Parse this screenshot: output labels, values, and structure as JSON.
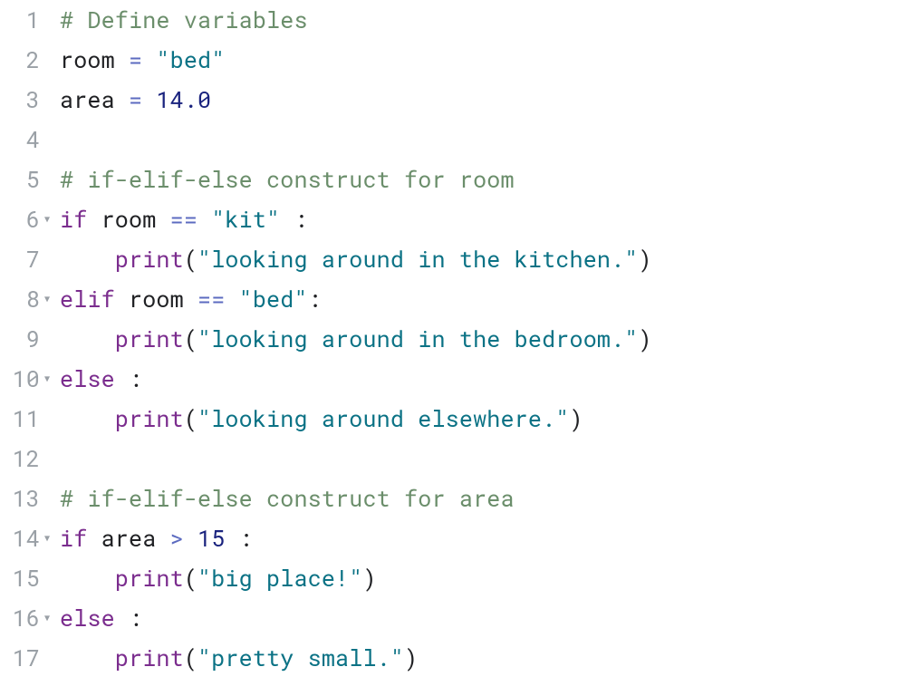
{
  "colors": {
    "comment": "#6b8e6b",
    "keyword": "#7b2d8e",
    "func": "#7b2d8e",
    "plain": "#202124",
    "operator": "#5c6bc0",
    "string": "#0b7285",
    "number": "#1a237e",
    "gutter": "#9aa0a6",
    "bg": "#ffffff"
  },
  "line_numbers": [
    "1",
    "2",
    "3",
    "4",
    "5",
    "6",
    "7",
    "8",
    "9",
    "10",
    "11",
    "12",
    "13",
    "14",
    "15",
    "16",
    "17"
  ],
  "fold_markers": {
    "6": "▼",
    "8": "▼",
    "10": "▼",
    "14": "▼",
    "16": "▼"
  },
  "lines": [
    [
      {
        "cls": "cm",
        "t": "# Define variables"
      }
    ],
    [
      {
        "cls": "var",
        "t": "room"
      },
      {
        "cls": "var",
        "t": " "
      },
      {
        "cls": "op",
        "t": "="
      },
      {
        "cls": "var",
        "t": " "
      },
      {
        "cls": "str",
        "t": "\"bed\""
      }
    ],
    [
      {
        "cls": "var",
        "t": "area"
      },
      {
        "cls": "var",
        "t": " "
      },
      {
        "cls": "op",
        "t": "="
      },
      {
        "cls": "var",
        "t": " "
      },
      {
        "cls": "num",
        "t": "14.0"
      }
    ],
    [
      {
        "cls": "var",
        "t": ""
      }
    ],
    [
      {
        "cls": "cm",
        "t": "# if-elif-else construct for room"
      }
    ],
    [
      {
        "cls": "kw",
        "t": "if"
      },
      {
        "cls": "var",
        "t": " room "
      },
      {
        "cls": "op",
        "t": "=="
      },
      {
        "cls": "var",
        "t": " "
      },
      {
        "cls": "str",
        "t": "\"kit\""
      },
      {
        "cls": "var",
        "t": " "
      },
      {
        "cls": "pn",
        "t": ":"
      }
    ],
    [
      {
        "cls": "var",
        "t": "    "
      },
      {
        "cls": "fn",
        "t": "print"
      },
      {
        "cls": "pn",
        "t": "("
      },
      {
        "cls": "str",
        "t": "\"looking around in the kitchen.\""
      },
      {
        "cls": "pn",
        "t": ")"
      }
    ],
    [
      {
        "cls": "kw",
        "t": "elif"
      },
      {
        "cls": "var",
        "t": " room "
      },
      {
        "cls": "op",
        "t": "=="
      },
      {
        "cls": "var",
        "t": " "
      },
      {
        "cls": "str",
        "t": "\"bed\""
      },
      {
        "cls": "pn",
        "t": ":"
      }
    ],
    [
      {
        "cls": "var",
        "t": "    "
      },
      {
        "cls": "fn",
        "t": "print"
      },
      {
        "cls": "pn",
        "t": "("
      },
      {
        "cls": "str",
        "t": "\"looking around in the bedroom.\""
      },
      {
        "cls": "pn",
        "t": ")"
      }
    ],
    [
      {
        "cls": "kw",
        "t": "else"
      },
      {
        "cls": "var",
        "t": " "
      },
      {
        "cls": "pn",
        "t": ":"
      }
    ],
    [
      {
        "cls": "var",
        "t": "    "
      },
      {
        "cls": "fn",
        "t": "print"
      },
      {
        "cls": "pn",
        "t": "("
      },
      {
        "cls": "str",
        "t": "\"looking around elsewhere.\""
      },
      {
        "cls": "pn",
        "t": ")"
      }
    ],
    [
      {
        "cls": "var",
        "t": ""
      }
    ],
    [
      {
        "cls": "cm",
        "t": "# if-elif-else construct for area"
      }
    ],
    [
      {
        "cls": "kw",
        "t": "if"
      },
      {
        "cls": "var",
        "t": " area "
      },
      {
        "cls": "op",
        "t": ">"
      },
      {
        "cls": "var",
        "t": " "
      },
      {
        "cls": "num",
        "t": "15"
      },
      {
        "cls": "var",
        "t": " "
      },
      {
        "cls": "pn",
        "t": ":"
      }
    ],
    [
      {
        "cls": "var",
        "t": "    "
      },
      {
        "cls": "fn",
        "t": "print"
      },
      {
        "cls": "pn",
        "t": "("
      },
      {
        "cls": "str",
        "t": "\"big place!\""
      },
      {
        "cls": "pn",
        "t": ")"
      }
    ],
    [
      {
        "cls": "kw",
        "t": "else"
      },
      {
        "cls": "var",
        "t": " "
      },
      {
        "cls": "pn",
        "t": ":"
      }
    ],
    [
      {
        "cls": "var",
        "t": "    "
      },
      {
        "cls": "fn",
        "t": "print"
      },
      {
        "cls": "pn",
        "t": "("
      },
      {
        "cls": "str",
        "t": "\"pretty small.\""
      },
      {
        "cls": "pn",
        "t": ")"
      }
    ]
  ]
}
